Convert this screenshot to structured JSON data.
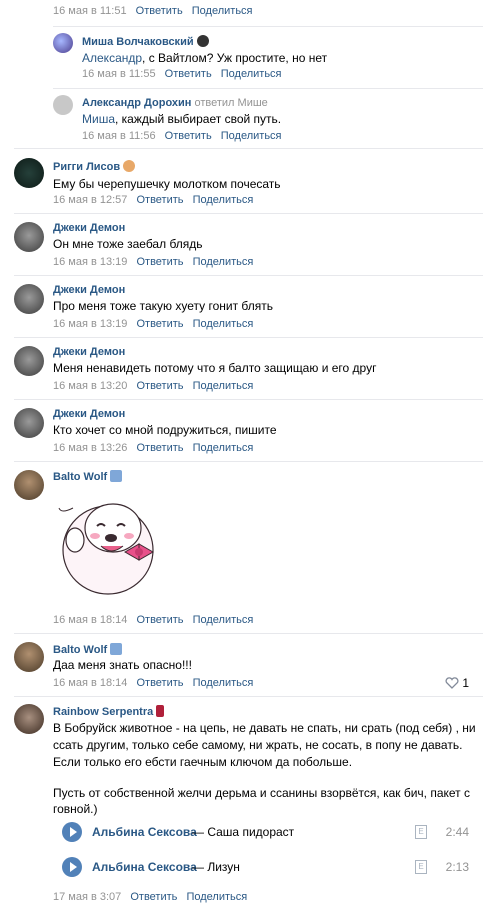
{
  "actions": {
    "reply": "Ответить",
    "share": "Поделиться"
  },
  "comments": [
    {
      "date": "16 мая в 11:51"
    },
    {
      "author": "Миша Волчаковский",
      "text_pre": "Александр",
      "text": ", с Вайтлом? Уж простите, но нет",
      "date": "16 мая в 11:55"
    },
    {
      "author": "Александр Дорохин",
      "replied": "ответил Мише",
      "text_pre": "Миша",
      "text": ", каждый выбирает свой путь.",
      "date": "16 мая в 11:56"
    },
    {
      "author": "Ригги Лисов",
      "text": "Ему бы черепушечку молотком почесать",
      "date": "16 мая в 12:57"
    },
    {
      "author": "Джеки Демон",
      "text": "Он мне тоже заебал блядь",
      "date": "16 мая в 13:19"
    },
    {
      "author": "Джеки Демон",
      "text": "Про меня тоже такую хуету гонит блять",
      "date": "16 мая в 13:19"
    },
    {
      "author": "Джеки Демон",
      "text": "Меня ненавидеть потому что я балто защищаю и его друг",
      "date": "16 мая в 13:20"
    },
    {
      "author": "Джеки Демон",
      "text": "Кто хочет со мной подружиться, пишите",
      "date": "16 мая в 13:26"
    },
    {
      "author": "Balto Wolf",
      "date": "16 мая в 18:14"
    },
    {
      "author": "Balto Wolf",
      "text": "Даа меня знать опасно!!!",
      "date": "16 мая в 18:14",
      "likes": "1"
    },
    {
      "author": "Rainbow Serpentra",
      "lines": [
        "В Бобруйск животное - на цепь, не давать не спать, ни срать (под себя) , ни",
        "ссать другим, только себе самому, ни жрать, не сосать, в попу не давать.",
        "Если только его ебсти гаечным ключом да побольше.",
        "",
        "Пусть от собственной желчи дерьма и ссанины взорвётся, как бич, пакет с",
        "говной.)"
      ],
      "date": "17 мая в 3:07"
    }
  ],
  "audio": [
    {
      "artist": "Альбина Сексова",
      "title": "— Саша пидораст",
      "duration": "2:44"
    },
    {
      "artist": "Альбина Сексова",
      "title": "— Лизун",
      "duration": "2:13"
    }
  ],
  "colors": {
    "link": "#2a5885",
    "meta": "#939393",
    "play": "#5181b8"
  },
  "icons": {
    "like": "heart-icon",
    "play": "play-icon",
    "lyrics": "lyrics-icon"
  }
}
